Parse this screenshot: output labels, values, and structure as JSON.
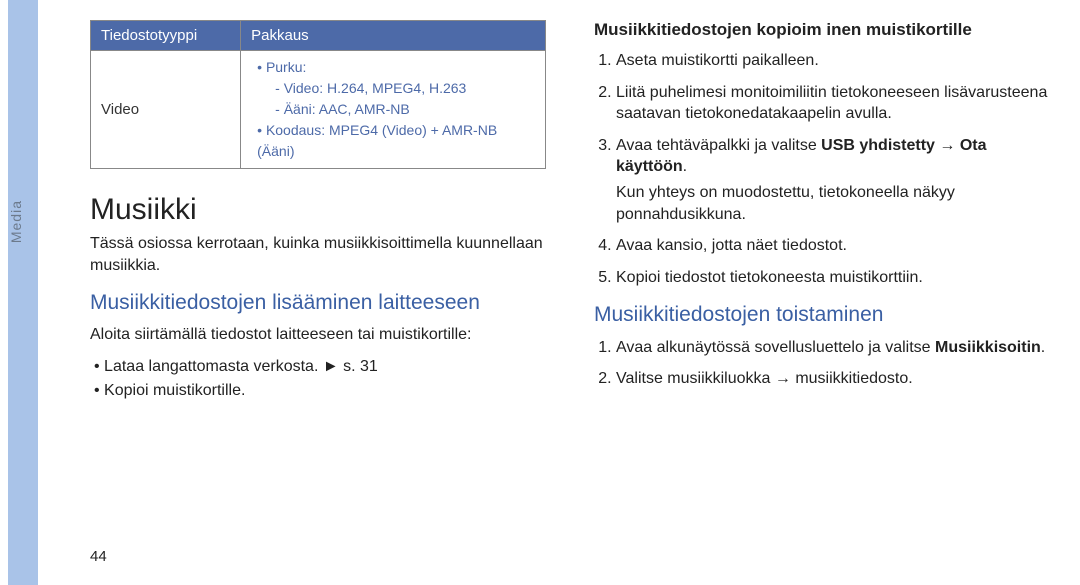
{
  "sideTab": "Media",
  "pageNumber": "44",
  "table": {
    "headers": [
      "Tiedostotyyppi",
      "Pakkaus"
    ],
    "row": {
      "col1": "Video",
      "codec": {
        "purku_label": "Purku:",
        "purku_video": "Video: H.264, MPEG4, H.263",
        "purku_audio": "Ääni: AAC, AMR-NB",
        "koodaus": "Koodaus: MPEG4 (Video) + AMR-NB (Ääni)"
      }
    }
  },
  "left": {
    "h1": "Musiikki",
    "intro": "Tässä osiossa kerrotaan, kuinka musiikkisoittimella kuunnellaan musiikkia.",
    "h2": "Musiikkitiedostojen lisääminen laitteeseen",
    "lead": "Aloita siirtämällä tiedostot laitteeseen tai muistikortille:",
    "bullets": [
      "Lataa langattomasta verkosta.  ► s. 31",
      "Kopioi muistikortille."
    ]
  },
  "right": {
    "h3": "Musiikkitiedostojen kopioim inen muistikortille",
    "steps1": [
      "Aseta muistikortti paikalleen.",
      "Liitä puhelimesi monitoimiliitin tietokoneeseen lisävarusteena saatavan tietokonedatakaapelin avulla."
    ],
    "step3_pre": "Avaa tehtäväpalkki ja valitse ",
    "step3_bold1": "USB yhdistetty",
    "step3_arrow": " → ",
    "step3_bold2": "Ota käyttöön",
    "step3_post": ".",
    "step3_note": "Kun yhteys on muodostettu, tietokoneella näkyy ponnahdusikkuna.",
    "steps_rest": [
      "Avaa kansio, jotta näet tiedostot.",
      "Kopioi tiedostot tietokoneesta muistikorttiin."
    ],
    "h2b": "Musiikkitiedostojen toistaminen",
    "play_step1_pre": "Avaa alkunäytössä sovellusluettelo ja valitse ",
    "play_step1_bold": "Musiikkisoitin",
    "play_step1_post": ".",
    "play_step2": "Valitse musiikkiluokka → musiikkitiedosto."
  }
}
